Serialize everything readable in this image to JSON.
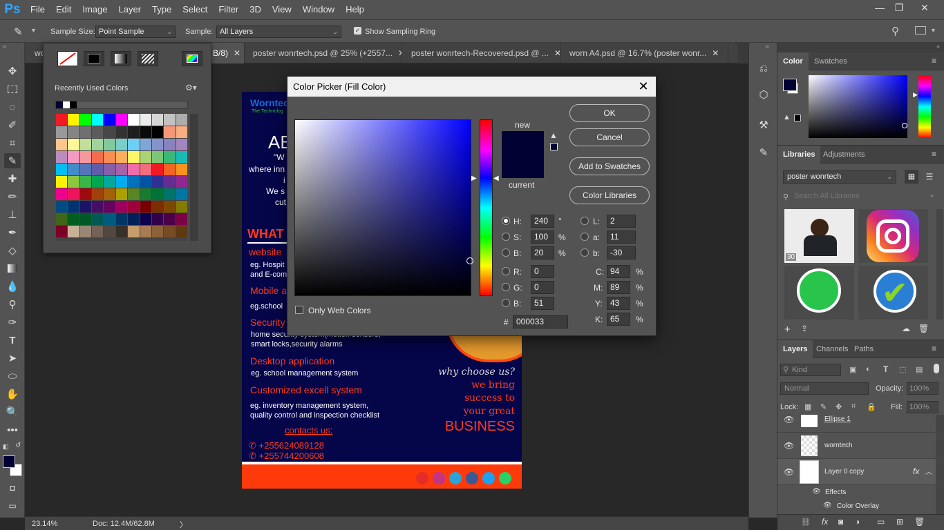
{
  "app": {
    "logo": "Ps"
  },
  "menu": [
    "File",
    "Edit",
    "Image",
    "Layer",
    "Type",
    "Select",
    "Filter",
    "3D",
    "View",
    "Window",
    "Help"
  ],
  "window_controls": {
    "min": "—",
    "restore": "❐",
    "close": "✕"
  },
  "options": {
    "sample_size_label": "Sample Size:",
    "sample_size_value": "Point Sample",
    "sample_label": "Sample:",
    "sample_value": "All Layers",
    "show_ring_label": "Show Sampling Ring",
    "show_ring_checked": true
  },
  "tabs": [
    {
      "label": "wo",
      "close": ""
    },
    {
      "label": "B/8)",
      "close": "✕"
    },
    {
      "label": "poster wonrtech.psd @ 25% (+2557...",
      "close": "✕"
    },
    {
      "label": "poster wonrtech-Recovered.psd @ ...",
      "close": "✕"
    },
    {
      "label": "worn A4.psd @ 16.7% (poster wonr...",
      "close": "✕"
    }
  ],
  "status": {
    "zoom": "23.14%",
    "doc": "Doc: 12.4M/62.8M"
  },
  "swatch_popup": {
    "recent_label": "Recently Used Colors",
    "recent_colors": [
      "#000033",
      "#ffffff",
      "#000000"
    ],
    "swatches": [
      "#ed1c24",
      "#fff200",
      "#00ff00",
      "#00ffff",
      "#0000ff",
      "#ff00ff",
      "#ffffff",
      "#ebebeb",
      "#d6d6d6",
      "#c2c2c2",
      "#adadad",
      "#999999",
      "#858585",
      "#707070",
      "#5c5c5c",
      "#474747",
      "#333333",
      "#1f1f1f",
      "#0a0a0a",
      "#000000",
      "#f7977a",
      "#fbad82",
      "#fdc68c",
      "#fff79a",
      "#c4df9b",
      "#a2d39c",
      "#82ca9c",
      "#7bcdc8",
      "#6ecff6",
      "#7ea7d8",
      "#8493ca",
      "#8882be",
      "#a187be",
      "#bc8cbf",
      "#f49ac2",
      "#f6989d",
      "#f26c4f",
      "#f68e56",
      "#fbaf5d",
      "#fff568",
      "#acd373",
      "#7cc576",
      "#3bb878",
      "#1abbb4",
      "#00bff3",
      "#438cca",
      "#5574b9",
      "#605ca8",
      "#855fa8",
      "#a763a8",
      "#f06ea9",
      "#f26d7d",
      "#ed1c24",
      "#f26522",
      "#f7941d",
      "#fff200",
      "#8dc73f",
      "#39b54a",
      "#00a651",
      "#00a99d",
      "#00aeef",
      "#0072bc",
      "#0054a6",
      "#2e3192",
      "#662d91",
      "#92278f",
      "#ec008c",
      "#ed145b",
      "#9e0b0f",
      "#a0410d",
      "#a36209",
      "#aba000",
      "#598527",
      "#197b30",
      "#007236",
      "#00746b",
      "#0076a3",
      "#004b80",
      "#003471",
      "#1b1464",
      "#440e62",
      "#630460",
      "#9e005d",
      "#9e0039",
      "#790000",
      "#7b2e00",
      "#7d4900",
      "#827b00",
      "#406618",
      "#005e20",
      "#005826",
      "#005952",
      "#005b7f",
      "#003663",
      "#002157",
      "#0d004c",
      "#32004b",
      "#4b0049",
      "#7b0046",
      "#7a0026",
      "#c7b299",
      "#998675",
      "#736357",
      "#534741",
      "#37302a",
      "#c69c6d",
      "#a67c52",
      "#8c6239",
      "#754c24",
      "#603913"
    ]
  },
  "dialog": {
    "title": "Color Picker (Fill Color)",
    "close": "✕",
    "new_label": "new",
    "current_label": "current",
    "buttons": {
      "ok": "OK",
      "cancel": "Cancel",
      "add": "Add to Swatches",
      "libs": "Color Libraries"
    },
    "only_web": "Only Web Colors",
    "fields": {
      "H": "240",
      "S": "100",
      "Bv": "20",
      "R": "0",
      "G": "0",
      "Bb": "51",
      "L": "2",
      "a": "11",
      "b": "-30",
      "C": "94",
      "M": "89",
      "Y": "43",
      "K": "65",
      "hex": "000033"
    },
    "labels": {
      "H": "H:",
      "S": "S:",
      "Bv": "B:",
      "R": "R:",
      "G": "G:",
      "Bb": "B:",
      "L": "L:",
      "a": "a:",
      "b": "b:",
      "C": "C:",
      "M": "M:",
      "Y": "Y:",
      "K": "K:",
      "hash": "#"
    },
    "units": {
      "deg": "°",
      "pct": "%"
    },
    "new_color": "#000033",
    "current_color": "#000033",
    "hue_color": "#0000ff"
  },
  "poster": {
    "brand1": "Worntech",
    "brand2": "The Technolog",
    "about": "AB",
    "quote": "\"W",
    "line1": "where inn",
    "line2": "i",
    "line3": "We s",
    "line4": "cut",
    "what": "WHAT",
    "website": "website",
    "eg_hosp": "eg. Hospit",
    "and_ecom": "and E-com",
    "mobile": "Mobile a",
    "eg_school": "eg.school",
    "security": "Security",
    "home_sec": "home security system(motion sensors,",
    "smart": "smart locks,security alarms",
    "desktop": "Desktop application",
    "eg_sms": "eg. school management system",
    "excel": "Customized excell system",
    "inv": "eg. inventory management system,",
    "qc": "quality control and inspection  checklist",
    "why": "why choose us?",
    "we_bring": "we bring",
    "success": "success to",
    "your_great": "your great",
    "business": "BUSINESS",
    "contacts": "contacts us:",
    "phone1": "+255624089128",
    "phone2": "+255744200608"
  },
  "color_panel": {
    "tab1": "Color",
    "tab2": "Swatches",
    "fg": "#000033",
    "bg": "#ffffff"
  },
  "libraries": {
    "tab1": "Libraries",
    "tab2": "Adjustments",
    "lib_name": "poster wonrtech",
    "search_placeholder": "Search All Libraries",
    "thumb_badge": "30"
  },
  "layers": {
    "tab1": "Layers",
    "tab2": "Channels",
    "tab3": "Paths",
    "kind": "Kind",
    "blend": "Normal",
    "opacity_label": "Opacity:",
    "opacity": "100%",
    "lock_label": "Lock:",
    "fill_label": "Fill:",
    "fill": "100%",
    "rows": [
      "Ellipse 1",
      "worntech",
      "Layer 0 copy"
    ],
    "effects": "Effects",
    "color_overlay": "Color Overlay",
    "fx": "fx"
  }
}
